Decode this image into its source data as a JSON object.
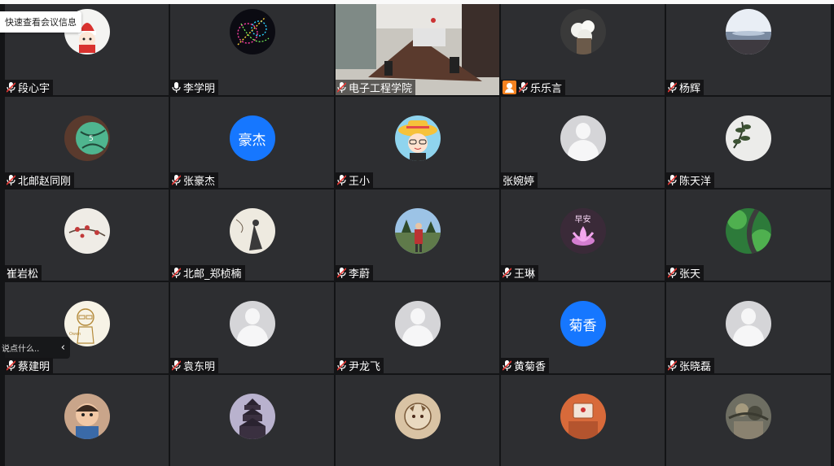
{
  "tooltip": "快速查看会议信息",
  "chat": {
    "placeholder": "说点什么..",
    "collapse_icon": "chevron-left-icon"
  },
  "colors": {
    "tile_bg": "#2d2e31",
    "avatar_blue": "#1677ff",
    "host_badge": "#f58220"
  },
  "participants": [
    {
      "name": "段心宇",
      "mic": "muted",
      "avatar": "photo"
    },
    {
      "name": "李学明",
      "mic": "on",
      "avatar": "photo"
    },
    {
      "name": "电子工程学院",
      "mic": "muted",
      "avatar": "video"
    },
    {
      "name": "乐乐言",
      "mic": "muted",
      "avatar": "photo",
      "host_badge": true
    },
    {
      "name": "杨辉",
      "mic": "muted",
      "avatar": "photo"
    },
    {
      "name": "北邮赵同刚",
      "mic": "muted",
      "avatar": "photo"
    },
    {
      "name": "张豪杰",
      "mic": "muted",
      "avatar": "text",
      "avatar_text": "豪杰"
    },
    {
      "name": "王小",
      "mic": "muted",
      "avatar": "photo"
    },
    {
      "name": "张婉婷",
      "mic": "none",
      "avatar": "default"
    },
    {
      "name": "陈天洋",
      "mic": "muted",
      "avatar": "photo"
    },
    {
      "name": "崔岩松",
      "mic": "none",
      "avatar": "photo"
    },
    {
      "name": "北邮_郑桢楠",
      "mic": "muted",
      "avatar": "photo"
    },
    {
      "name": "李蔚",
      "mic": "muted",
      "avatar": "photo"
    },
    {
      "name": "王琳",
      "mic": "muted",
      "avatar": "photo",
      "avatar_text": "早安"
    },
    {
      "name": "张天",
      "mic": "muted",
      "avatar": "photo"
    },
    {
      "name": "蔡建明",
      "mic": "muted",
      "avatar": "photo"
    },
    {
      "name": "袁东明",
      "mic": "muted",
      "avatar": "default"
    },
    {
      "name": "尹龙飞",
      "mic": "muted",
      "avatar": "default"
    },
    {
      "name": "黄菊香",
      "mic": "muted",
      "avatar": "text",
      "avatar_text": "菊香"
    },
    {
      "name": "张晓磊",
      "mic": "muted",
      "avatar": "default"
    },
    {
      "name": "",
      "mic": "none",
      "avatar": "photo"
    },
    {
      "name": "",
      "mic": "none",
      "avatar": "photo"
    },
    {
      "name": "",
      "mic": "none",
      "avatar": "photo"
    },
    {
      "name": "",
      "mic": "none",
      "avatar": "photo"
    },
    {
      "name": "",
      "mic": "none",
      "avatar": "photo"
    }
  ]
}
